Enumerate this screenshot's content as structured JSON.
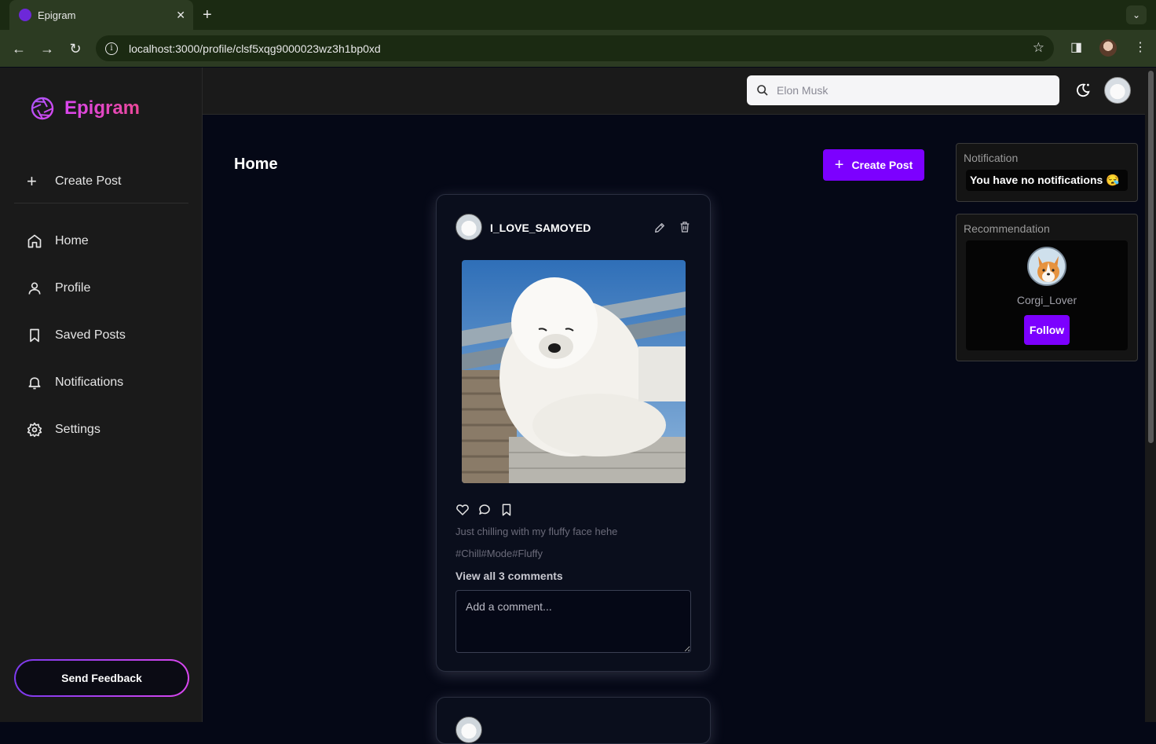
{
  "browser": {
    "tab_title": "Epigram",
    "tab_close": "✕",
    "new_tab": "+",
    "url": "localhost:3000/profile/clsf5xqg9000023wz3h1bp0xd"
  },
  "brand": {
    "name": "Epigram",
    "accent": "#7c00ff"
  },
  "sidebar": {
    "create_label": "Create Post",
    "items": [
      {
        "label": "Home",
        "icon": "home-icon"
      },
      {
        "label": "Profile",
        "icon": "user-icon"
      },
      {
        "label": "Saved Posts",
        "icon": "bookmark-icon"
      },
      {
        "label": "Notifications",
        "icon": "bell-icon"
      },
      {
        "label": "Settings",
        "icon": "gear-icon"
      }
    ],
    "feedback_label": "Send Feedback"
  },
  "search": {
    "placeholder": "Elon Musk"
  },
  "main": {
    "title": "Home",
    "create_button": "Create Post"
  },
  "post": {
    "username": "I_LOVE_SAMOYED",
    "caption": "Just chilling with my fluffy face hehe",
    "tags": "#Chill#Mode#Fluffy",
    "comments_link": "View all 3 comments",
    "comment_placeholder": "Add a comment..."
  },
  "notification_panel": {
    "title": "Notification",
    "message": "You have no notifications 😪"
  },
  "recommendation_panel": {
    "title": "Recommendation",
    "user": "Corgi_Lover",
    "follow_label": "Follow"
  }
}
